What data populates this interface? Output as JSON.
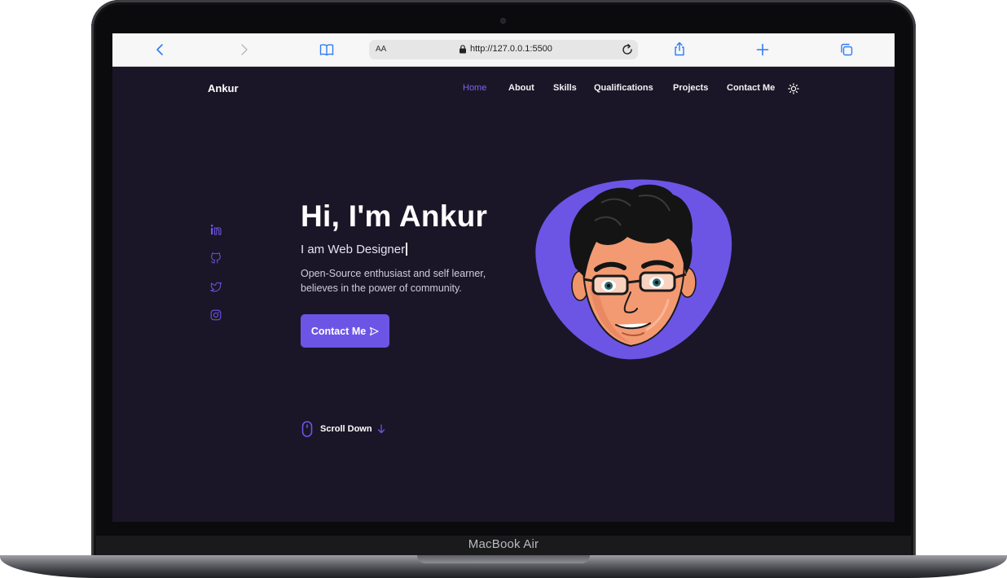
{
  "device": {
    "model_label": "MacBook Air"
  },
  "browser": {
    "text_size_label": "AA",
    "url": "http://127.0.0.1:5500"
  },
  "site": {
    "brand": "Ankur",
    "nav": [
      {
        "label": "Home",
        "active": true
      },
      {
        "label": "About",
        "active": false
      },
      {
        "label": "Skills",
        "active": false
      },
      {
        "label": "Qualifications",
        "active": false
      },
      {
        "label": "Projects",
        "active": false
      },
      {
        "label": "Contact Me",
        "active": false
      }
    ],
    "social": [
      "linkedin-icon",
      "github-icon",
      "twitter-icon",
      "instagram-icon"
    ]
  },
  "hero": {
    "title": "Hi, I'm Ankur",
    "subtitle": "I am Web Designer",
    "description_lines": [
      "Open-Source enthusiast and self learner,",
      "believes in the power of community."
    ],
    "cta_label": "Contact Me",
    "scroll_label": "Scroll Down"
  },
  "colors": {
    "accent": "#6c55e5",
    "background": "#1b1627",
    "toolbar_blue": "#2f7cf6"
  }
}
